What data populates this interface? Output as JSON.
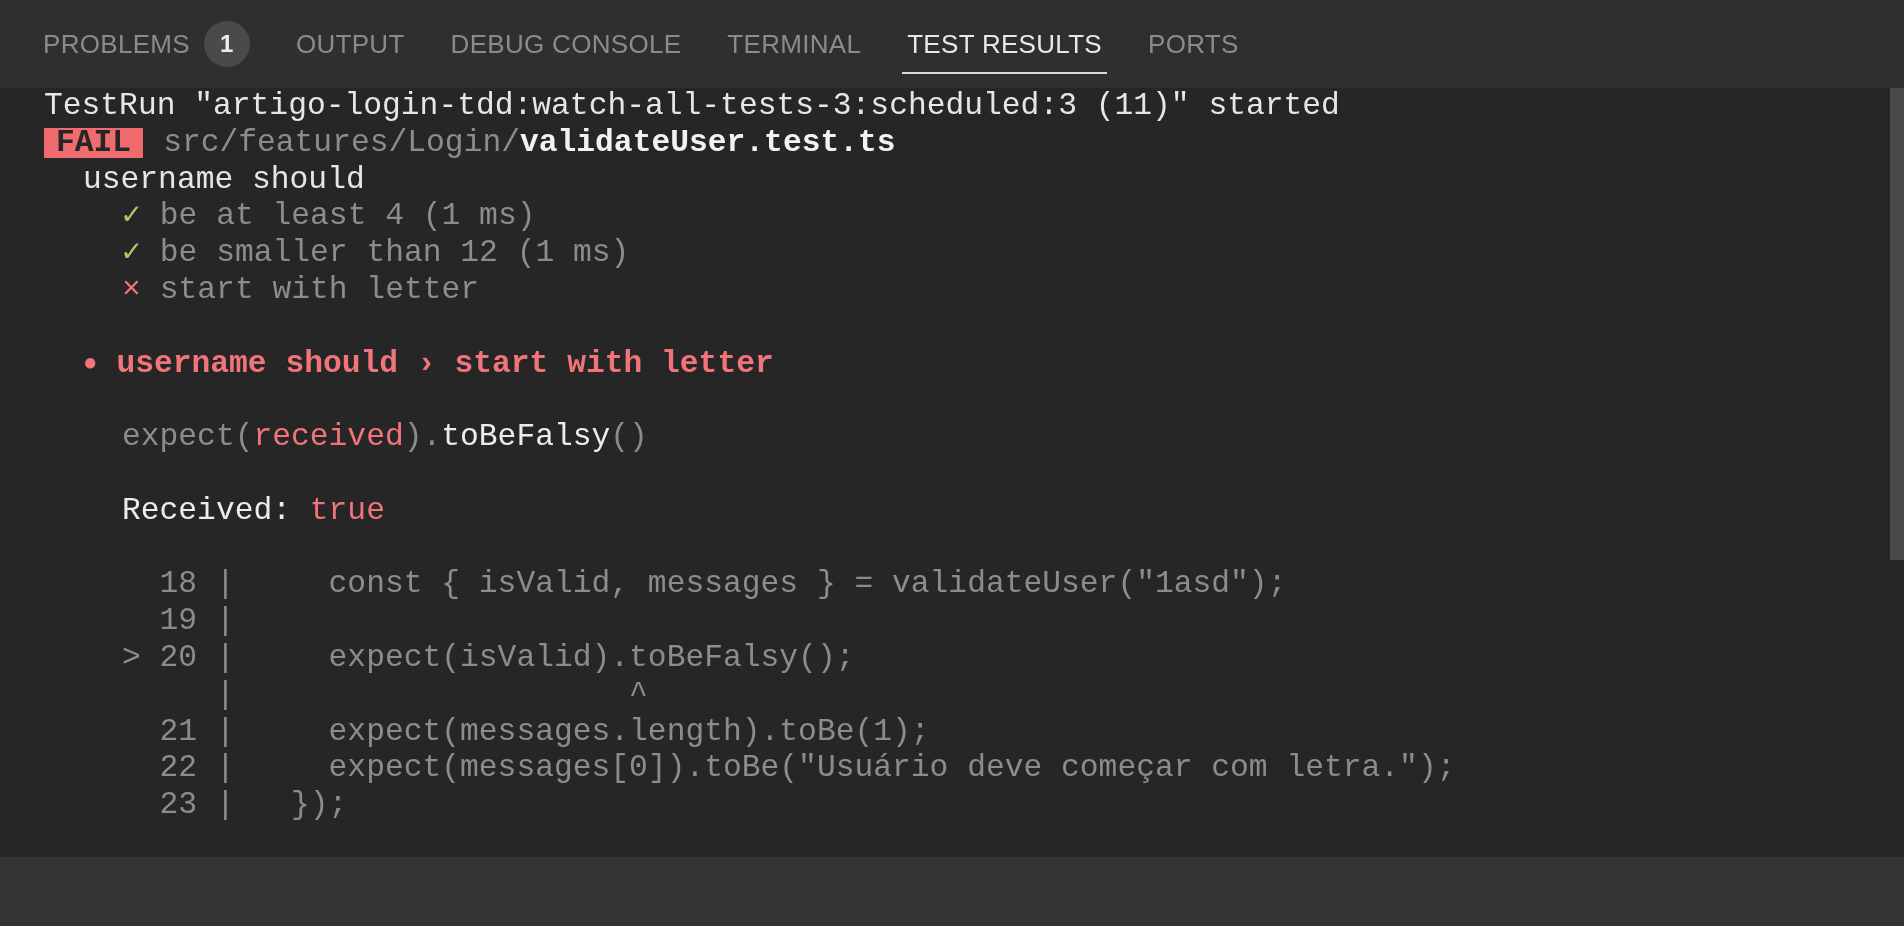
{
  "tabs": [
    {
      "label": "PROBLEMS",
      "badge": "1",
      "selected": false
    },
    {
      "label": "OUTPUT",
      "selected": false
    },
    {
      "label": "DEBUG CONSOLE",
      "selected": false
    },
    {
      "label": "TERMINAL",
      "selected": false
    },
    {
      "label": "TEST RESULTS",
      "selected": true
    },
    {
      "label": "PORTS",
      "selected": false
    }
  ],
  "output": {
    "run_line": "TestRun \"artigo-login-tdd:watch-all-tests-3:scheduled:3 (11)\" started",
    "result": {
      "status": "FAIL",
      "path": "src/features/Login/",
      "file": "validateUser.test.ts"
    },
    "suite": "username should",
    "tests": [
      {
        "passed": true,
        "mark": "✓",
        "name": "be at least 4 (1 ms)"
      },
      {
        "passed": true,
        "mark": "✓",
        "name": "be smaller than 12 (1 ms)"
      },
      {
        "passed": false,
        "mark": "×",
        "name": "start with letter"
      }
    ],
    "failure": {
      "bullet": "●",
      "title": "username should › start with letter",
      "assertion": [
        {
          "text": "expect(",
          "color": "#8c8c8c"
        },
        {
          "text": "received",
          "color": "#f0747a"
        },
        {
          "text": ").",
          "color": "#8c8c8c"
        },
        {
          "text": "toBeFalsy",
          "color": "#ececec"
        },
        {
          "text": "()",
          "color": "#8c8c8c"
        }
      ],
      "received_label": "Received:",
      "received_value": "true",
      "code_frame": [
        {
          "kind": "code",
          "number": "18",
          "gutter": "|",
          "code": "    const { isValid, messages } = validateUser(\"1asd\");"
        },
        {
          "kind": "code",
          "number": "19",
          "gutter": "|"
        },
        {
          "kind": "code",
          "marker": ">",
          "number": "20",
          "gutter": "|",
          "code": "    expect(isValid).toBeFalsy();"
        },
        {
          "kind": "caret",
          "gutter": "|",
          "code": "                    ^"
        },
        {
          "kind": "code",
          "number": "21",
          "gutter": "|",
          "code": "    expect(messages.length).toBe(1);"
        },
        {
          "kind": "code",
          "number": "22",
          "gutter": "|",
          "code": "    expect(messages[0]).toBe(\"Usuário deve começar com letra.\");"
        },
        {
          "kind": "code",
          "number": "23",
          "gutter": "|",
          "code": "  });"
        }
      ]
    }
  }
}
